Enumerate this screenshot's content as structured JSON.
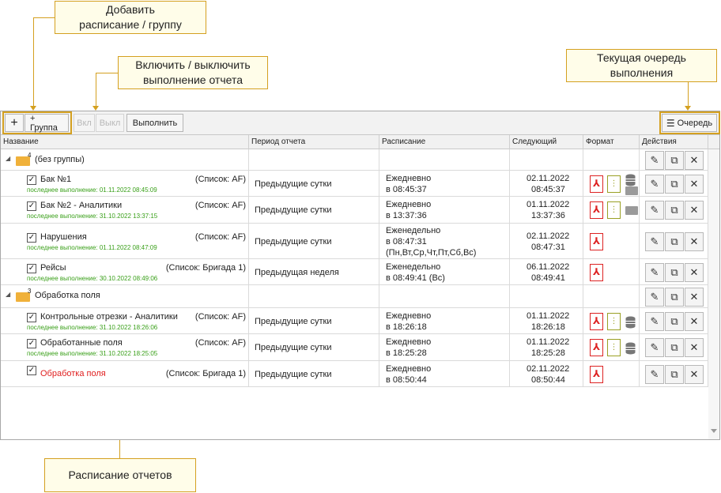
{
  "callouts": {
    "add_group": "Добавить\nрасписание / группу",
    "toggle": "Включить / выключить\nвыполнение отчета",
    "queue": "Текущая очередь\nвыполнения",
    "schedule": "Расписание отчетов"
  },
  "toolbar": {
    "add_label": "+",
    "group_label": "+ Группа",
    "on_label": "Вкл",
    "off_label": "Выкл",
    "run_label": "Выполнить",
    "queue_label": "Очередь"
  },
  "columns": [
    "Название",
    "Период отчета",
    "Расписание",
    "Следующий",
    "Формат",
    "Действия"
  ],
  "groups": [
    {
      "name": "(без группы)",
      "count": "4"
    },
    {
      "name": "Обработка поля",
      "count": "3"
    }
  ],
  "rows": [
    {
      "name": "Бак №1",
      "list": "(Список: AF)",
      "last": "последнее выполнение: 01.11.2022 08:45:09",
      "period": "Предыдущие сутки",
      "sched1": "Ежедневно",
      "sched2": "в 08:45:37",
      "sched3": "",
      "next_date": "02.11.2022",
      "next_time": "08:45:37",
      "formats": [
        "pdf",
        "zip",
        "db",
        "folder"
      ]
    },
    {
      "name": "Бак №2 - Аналитики",
      "list": "(Список: AF)",
      "last": "последнее выполнение: 31.10.2022 13:37:15",
      "period": "Предыдущие сутки",
      "sched1": "Ежедневно",
      "sched2": "в 13:37:36",
      "sched3": "",
      "next_date": "01.11.2022",
      "next_time": "13:37:36",
      "formats": [
        "pdf",
        "zip",
        "folder"
      ]
    },
    {
      "name": "Нарушения",
      "list": "(Список: AF)",
      "last": "последнее выполнение: 01.11.2022 08:47:09",
      "period": "Предыдущие сутки",
      "sched1": "Еженедельно",
      "sched2": "в 08:47:31",
      "sched3": "(Пн,Вт,Ср,Чт,Пт,Сб,Вс)",
      "next_date": "02.11.2022",
      "next_time": "08:47:31",
      "formats": [
        "pdf"
      ]
    },
    {
      "name": "Рейсы",
      "list": "(Список: Бригада 1)",
      "last": "последнее выполнение: 30.10.2022 08:49:06",
      "period": "Предыдущая неделя",
      "sched1": "Еженедельно",
      "sched2": "в 08:49:41 (Вс)",
      "sched3": "",
      "next_date": "06.11.2022",
      "next_time": "08:49:41",
      "formats": [
        "pdf"
      ]
    },
    {
      "name": "Контрольные отрезки - Аналитики",
      "list": "(Список: AF)",
      "last": "последнее выполнение: 31.10.2022 18:26:06",
      "period": "Предыдущие сутки",
      "sched1": "Ежедневно",
      "sched2": "в 18:26:18",
      "sched3": "",
      "next_date": "01.11.2022",
      "next_time": "18:26:18",
      "formats": [
        "pdf",
        "zip",
        "db"
      ]
    },
    {
      "name": "Обработанные поля",
      "list": "(Список: AF)",
      "last": "последнее выполнение: 31.10.2022 18:25:05",
      "period": "Предыдущие сутки",
      "sched1": "Ежедневно",
      "sched2": "в 18:25:28",
      "sched3": "",
      "next_date": "01.11.2022",
      "next_time": "18:25:28",
      "formats": [
        "pdf",
        "zip",
        "db"
      ]
    },
    {
      "name": "Обработка поля",
      "list": "(Список: Бригада 1)",
      "last": "",
      "period": "Предыдущие сутки",
      "sched1": "Ежедневно",
      "sched2": "в 08:50:44",
      "sched3": "",
      "next_date": "02.11.2022",
      "next_time": "08:50:44",
      "formats": [
        "pdf"
      ]
    }
  ],
  "icons": {
    "check": "✓",
    "pencil": "✎",
    "copy": "⧉",
    "close": "✕",
    "pdf": "⅄",
    "zip": "⋮",
    "expand": "◢",
    "queue": "☰"
  },
  "colors": {
    "accent": "#d4a020",
    "ok_text": "#3aa01a",
    "error_text": "#e02020",
    "pdf": "#d22222",
    "folder": "#f0b13a"
  }
}
